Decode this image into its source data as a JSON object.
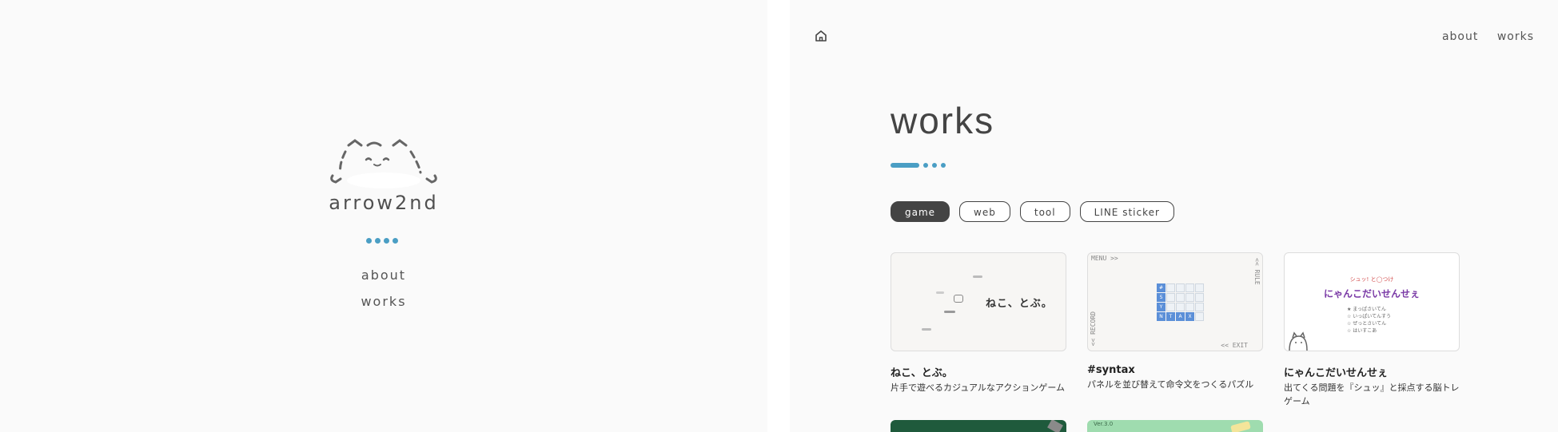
{
  "left": {
    "brand": "arrow2nd",
    "nav": [
      "about",
      "works"
    ]
  },
  "header": {
    "nav": [
      "about",
      "works"
    ]
  },
  "main": {
    "title": "works",
    "tabs": [
      "game",
      "web",
      "tool",
      "LINE sticker"
    ],
    "active_tab": "game",
    "cards": [
      {
        "title": "ねこ、とぶ。",
        "desc": "片手で遊べるカジュアルなアクションゲーム",
        "thumb_text": "ねこ、とぶ。"
      },
      {
        "title": "#syntax",
        "desc": "パネルを並び替えて命令文をつくるパズル",
        "thumb_menu": "MENU >>",
        "thumb_exit": "<< EXIT",
        "thumb_rule": "<< RULE",
        "thumb_record": "<< RECORD",
        "thumb_grid_letters": [
          "#",
          "S",
          "Y",
          "N",
          "T",
          "A",
          "X"
        ]
      },
      {
        "title": "にゃんこだいせんせぇ",
        "desc": "出てくる問題を『シュッ』と採点する脳トレゲーム",
        "thumb_small": "シュッ! と◯つけ",
        "thumb_big": "にゃんこだいせんせぇ",
        "thumb_options": [
          "★ まっぱさいてん",
          "☆ いっぱいてんすう",
          "☆ ぜっとさいてん",
          "☆ はいすこあ"
        ]
      }
    ],
    "bottom_thumb_version": "Ver.3.0"
  },
  "colors": {
    "accent": "#4a9ec4",
    "tab_active_bg": "#444444",
    "syntax_cell": "#5b8fd8"
  }
}
